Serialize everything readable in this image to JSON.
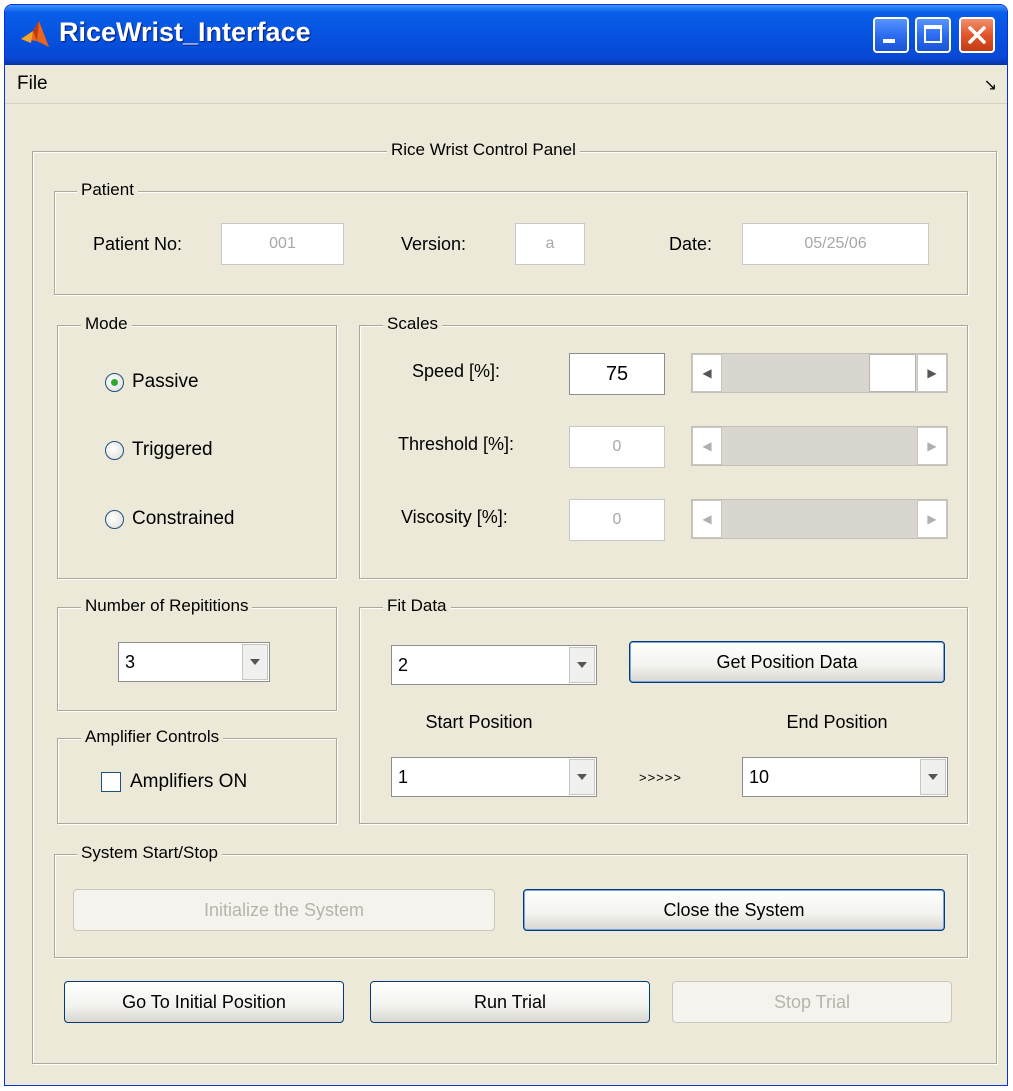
{
  "window": {
    "title": "RiceWrist_Interface",
    "buttons": {
      "minimize": "minimize-icon",
      "maximize": "maximize-icon",
      "close": "close-icon"
    }
  },
  "menu": {
    "file": "File",
    "dock_icon": "↘"
  },
  "control_panel": {
    "title": "Rice Wrist Control Panel"
  },
  "patient": {
    "title": "Patient",
    "patient_no_label": "Patient No:",
    "patient_no_value": "001",
    "version_label": "Version:",
    "version_value": "a",
    "date_label": "Date:",
    "date_value": "05/25/06"
  },
  "mode": {
    "title": "Mode",
    "options": [
      {
        "label": "Passive",
        "checked": true
      },
      {
        "label": "Triggered",
        "checked": false
      },
      {
        "label": "Constrained",
        "checked": false
      }
    ]
  },
  "scales": {
    "title": "Scales",
    "rows": [
      {
        "label": "Speed [%]:",
        "value": "75",
        "enabled": true,
        "slider_fraction": 0.75
      },
      {
        "label": "Threshold [%]:",
        "value": "0",
        "enabled": false,
        "slider_fraction": 0
      },
      {
        "label": "Viscosity [%]:",
        "value": "0",
        "enabled": false,
        "slider_fraction": 0
      }
    ]
  },
  "repetitions": {
    "title": "Number of Repititions",
    "selected": "3"
  },
  "amplifier": {
    "title": "Amplifier Controls",
    "checkbox_label": "Amplifiers ON",
    "checked": false
  },
  "fit_data": {
    "title": "Fit Data",
    "selected": "2",
    "get_position_button": "Get Position Data",
    "start_label": "Start Position",
    "start_value": "1",
    "arrows": ">>>>>",
    "end_label": "End Position",
    "end_value": "10"
  },
  "system": {
    "title": "System Start/Stop",
    "initialize_button": "Initialize the System",
    "close_button": "Close the System"
  },
  "bottom_buttons": {
    "go_initial": "Go To Initial Position",
    "run_trial": "Run Trial",
    "stop_trial": "Stop Trial"
  }
}
